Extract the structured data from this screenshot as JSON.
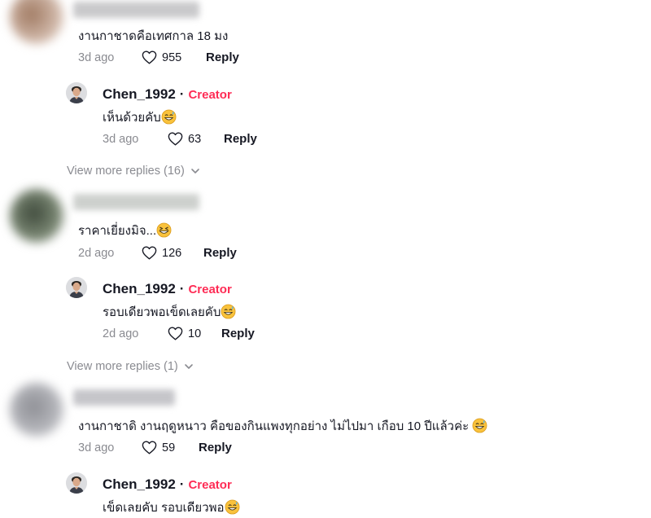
{
  "colors": {
    "accent": "#fe2c55",
    "muted": "#8a8b91",
    "text": "#161823"
  },
  "comments": [
    {
      "text": "งานกาชาดคือเทศกาล 18 มง",
      "time": "3d ago",
      "likes": "955",
      "reply_label": "Reply",
      "reply": {
        "author": "Chen_1992",
        "separator": "·",
        "badge": "Creator",
        "text": "เห็นด้วยคับ",
        "emoji": "grinning-sweat-icon",
        "time": "3d ago",
        "likes": "63",
        "reply_label": "Reply"
      },
      "view_more": "View more replies (16)"
    },
    {
      "text": "ราคาเยี่ยงมิจ...",
      "emoji": "grinning-squint-icon",
      "time": "2d ago",
      "likes": "126",
      "reply_label": "Reply",
      "reply": {
        "author": "Chen_1992",
        "separator": "·",
        "badge": "Creator",
        "text": "รอบเดียวพอเข็ดเลยคับ",
        "emoji": "grinning-sweat-icon",
        "time": "2d ago",
        "likes": "10",
        "reply_label": "Reply"
      },
      "view_more": "View more replies (1)"
    },
    {
      "text": "งานกาชาดิ งานฤดูหนาว คือของกินแพงทุกอย่าง ไม่ไปมา เกือบ 10 ปีแล้วค่ะ",
      "emoji": "grinning-sweat-icon",
      "time": "3d ago",
      "likes": "59",
      "reply_label": "Reply",
      "reply": {
        "author": "Chen_1992",
        "separator": "·",
        "badge": "Creator",
        "text": "เข็ดเลยคับ รอบเดียวพอ",
        "emoji": "grinning-sweat-icon"
      }
    }
  ]
}
